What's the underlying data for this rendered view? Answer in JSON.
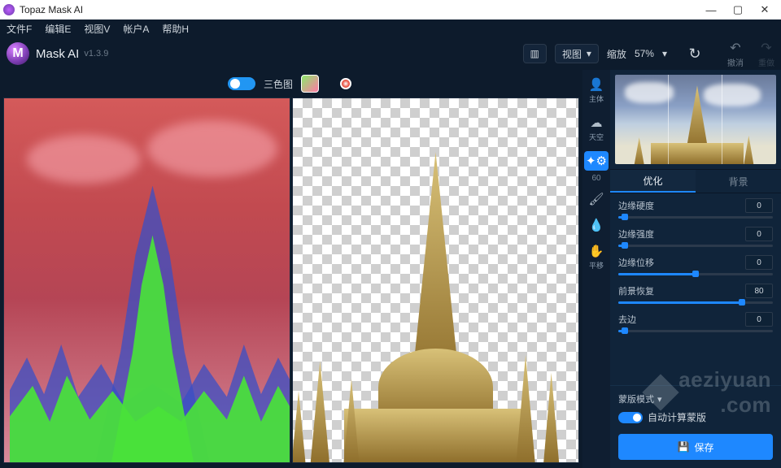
{
  "window": {
    "title": "Topaz Mask AI"
  },
  "menu": {
    "file": "文件F",
    "edit": "编辑E",
    "view": "视图V",
    "account": "帐户A",
    "help": "帮助H"
  },
  "header": {
    "logo_letter": "M",
    "product": "Mask AI",
    "version": "v1.3.9",
    "view_btn": "视图",
    "zoom_label": "缩放",
    "zoom_value": "57%",
    "refresh_label": "重置",
    "undo_label": "撤消",
    "redo_label": "重做"
  },
  "toolbar": {
    "trimap_label": "三色图"
  },
  "tools": {
    "subject": "主体",
    "sky": "天空",
    "brush_size": "60",
    "shift": "平移"
  },
  "tabs": {
    "refine": "优化",
    "background": "背景"
  },
  "sliders": [
    {
      "label": "边缘硬度",
      "value": "0",
      "pct": 4
    },
    {
      "label": "边缘强度",
      "value": "0",
      "pct": 4
    },
    {
      "label": "边缘位移",
      "value": "0",
      "pct": 50
    },
    {
      "label": "前景恢复",
      "value": "80",
      "pct": 80
    },
    {
      "label": "去边",
      "value": "0",
      "pct": 4
    }
  ],
  "mask": {
    "mode_label": "蒙版模式",
    "auto_label": "自动计算蒙版"
  },
  "save": {
    "label": "保存"
  },
  "watermark": {
    "line1": "aeziyuan",
    "line2": ".com"
  }
}
